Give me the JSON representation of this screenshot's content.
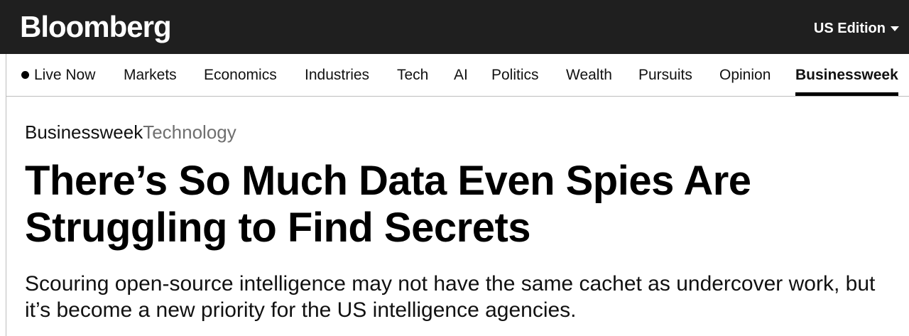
{
  "header": {
    "logo": "Bloomberg",
    "edition_label": "US Edition"
  },
  "nav": {
    "items": [
      {
        "label": "Live Now"
      },
      {
        "label": "Markets"
      },
      {
        "label": "Economics"
      },
      {
        "label": "Industries"
      },
      {
        "label": "Tech"
      },
      {
        "label": "AI"
      },
      {
        "label": "Politics"
      },
      {
        "label": "Wealth"
      },
      {
        "label": "Pursuits"
      },
      {
        "label": "Opinion"
      },
      {
        "label": "Businessweek",
        "active": true
      }
    ]
  },
  "article": {
    "kicker_primary": "Businessweek",
    "kicker_secondary": "Technology",
    "headline": "There’s So Much Data Even Spies Are Struggling to Find Secrets",
    "dek": "Scouring open-source intelligence may not have the same cachet as undercover work, but it’s become a new priority for the US intelligence agencies."
  },
  "colors": {
    "topbar_bg": "#1f1f1f",
    "text": "#000000",
    "secondary_text": "#6f6f6f",
    "divider": "#bdbdbd"
  },
  "icons": {
    "edition_dropdown": "caret-down-icon",
    "live_indicator": "live-dot-icon"
  }
}
